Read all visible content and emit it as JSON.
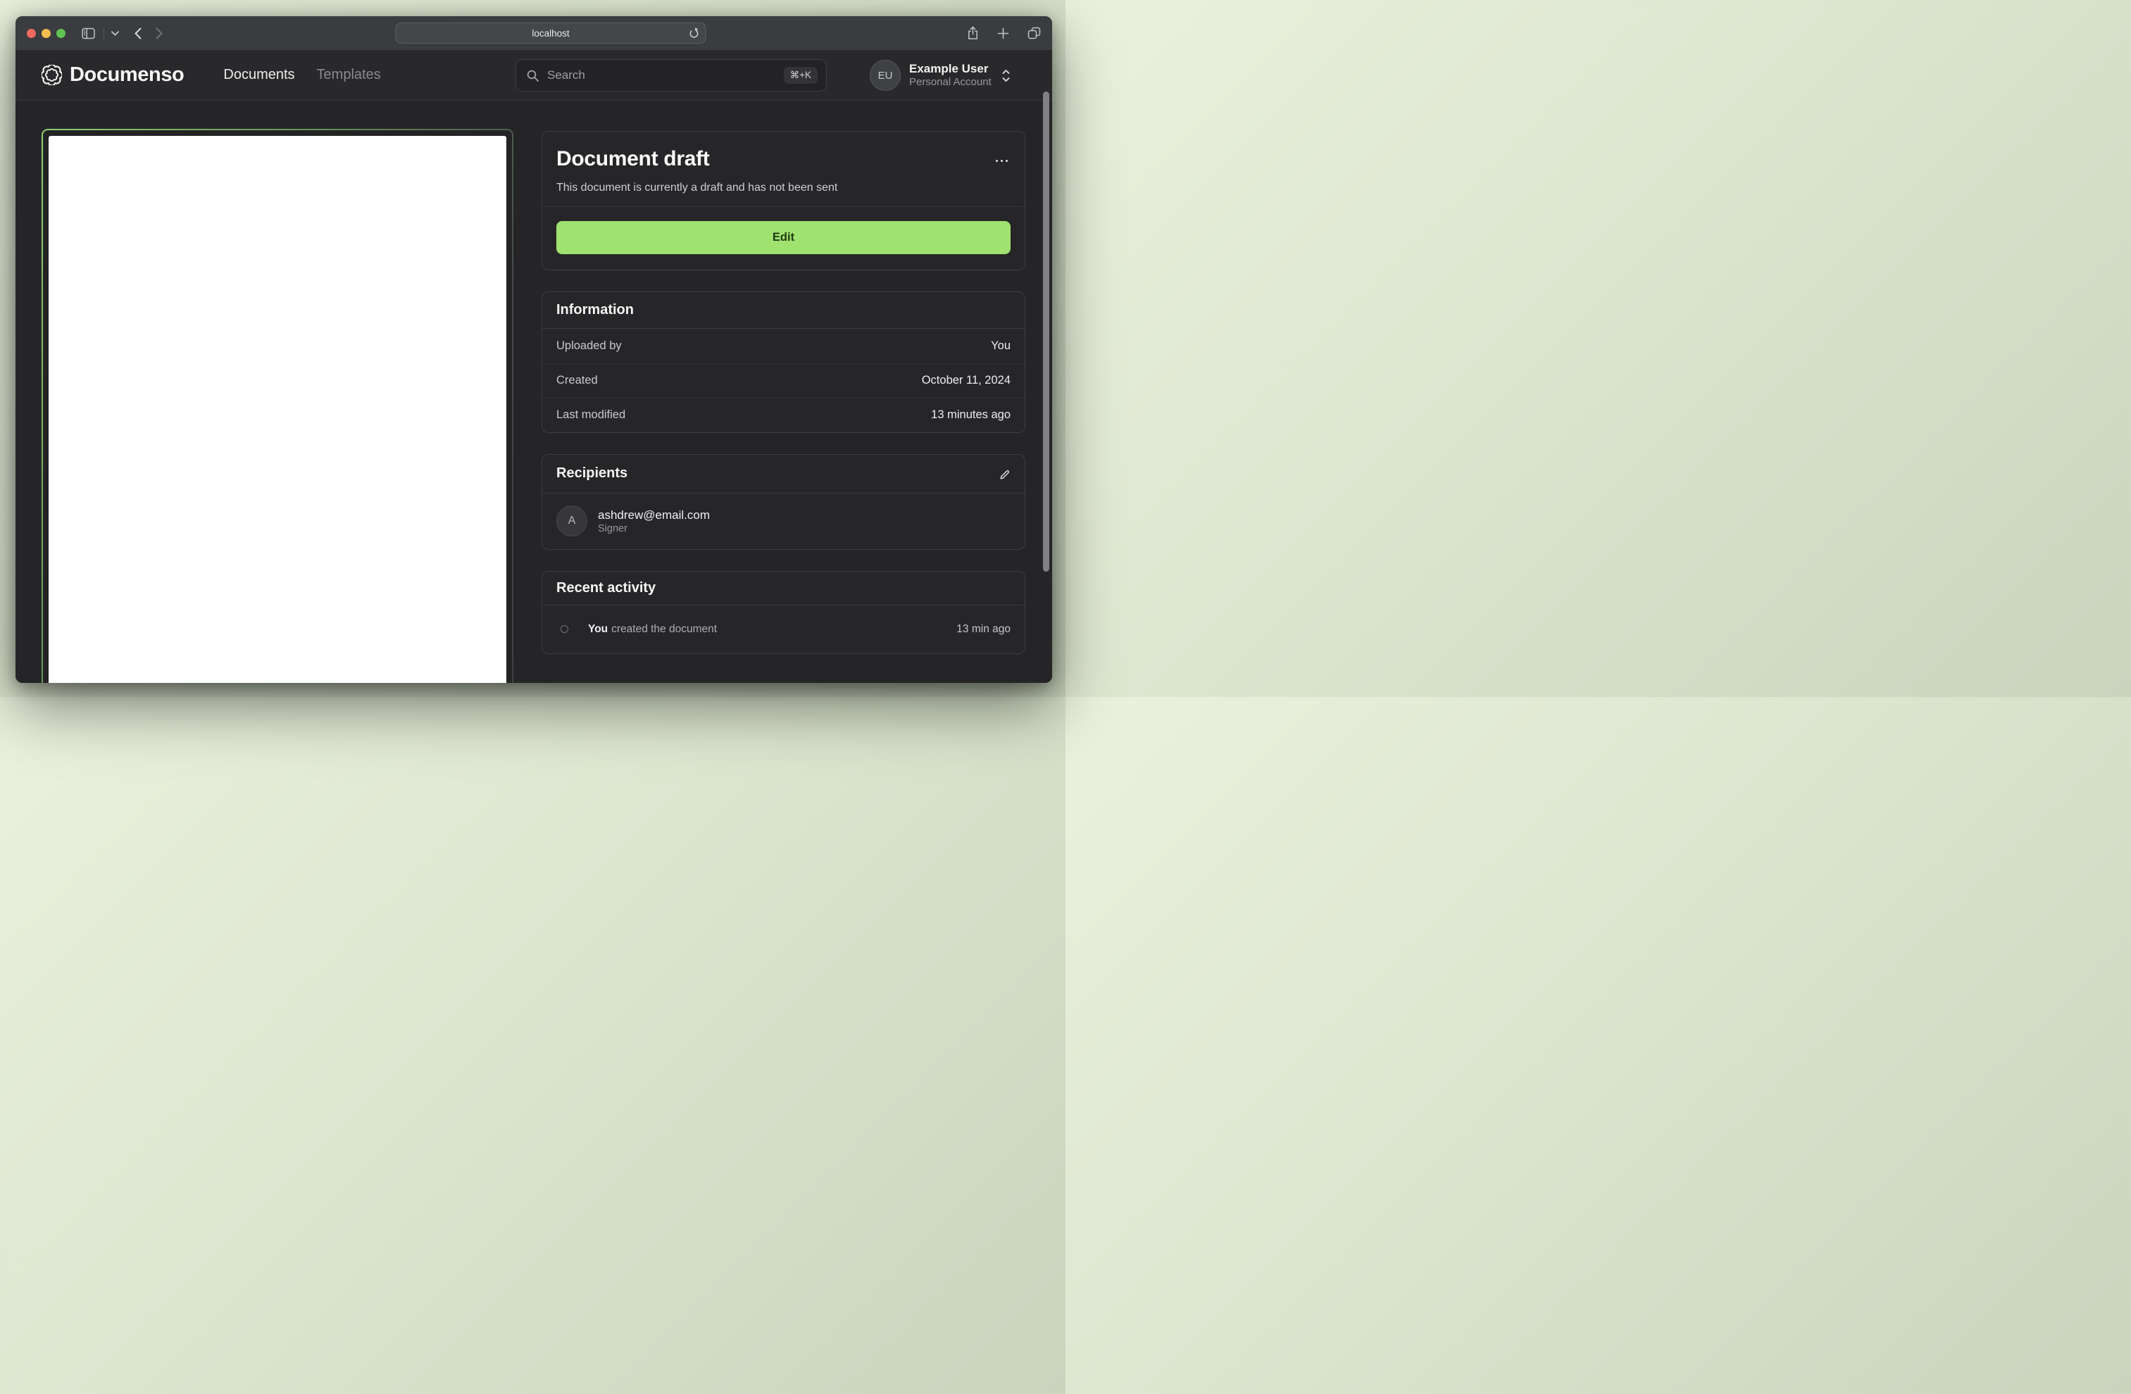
{
  "browser": {
    "url": "localhost"
  },
  "header": {
    "brand": "Documenso",
    "nav": [
      {
        "label": "Documents"
      },
      {
        "label": "Templates"
      }
    ],
    "search": {
      "placeholder": "Search",
      "shortcut": "⌘+K"
    },
    "user": {
      "initials": "EU",
      "name": "Example User",
      "account": "Personal Account"
    }
  },
  "draft_card": {
    "title": "Document draft",
    "subtitle": "This document is currently a draft and has not been sent",
    "edit_label": "Edit"
  },
  "info_card": {
    "title": "Information",
    "rows": [
      {
        "label": "Uploaded by",
        "value": "You"
      },
      {
        "label": "Created",
        "value": "October 11, 2024"
      },
      {
        "label": "Last modified",
        "value": "13 minutes ago"
      }
    ]
  },
  "recipients_card": {
    "title": "Recipients",
    "recipients": [
      {
        "initial": "A",
        "email": "ashdrew@email.com",
        "role": "Signer"
      }
    ]
  },
  "activity_card": {
    "title": "Recent activity",
    "items": [
      {
        "actor": "You",
        "action": "created the document",
        "time": "13 min ago"
      }
    ]
  },
  "colors": {
    "accent_green": "#a0e270",
    "border_gradient_green": "#8ed172",
    "desktop_sage": "#dce6cf",
    "app_background": "#252527"
  }
}
